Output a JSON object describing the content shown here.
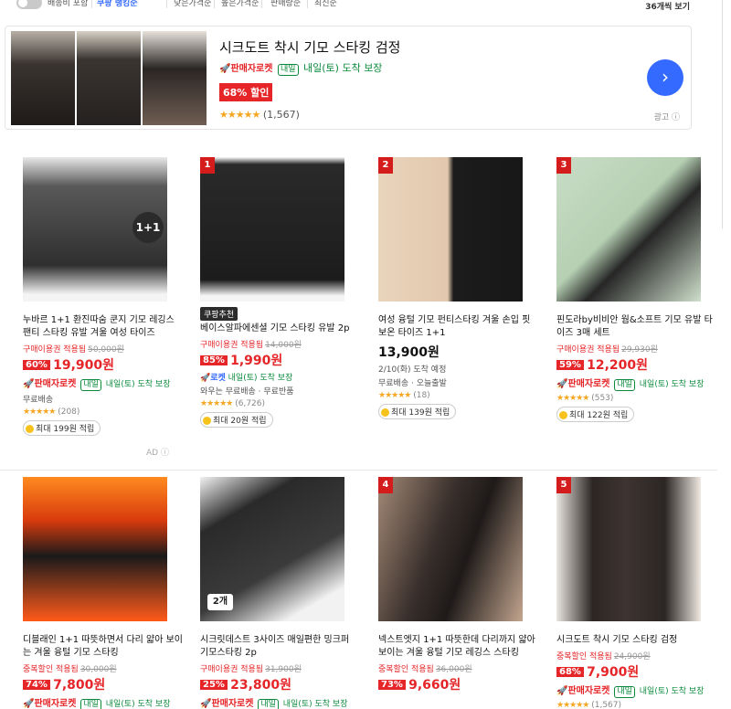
{
  "filters": {
    "delivery_toggle_label": "배송비 포함",
    "sort_options": [
      "쿠팡 랭킹순",
      "낮은가격순",
      "높은가격순",
      "판매량순",
      "최신순"
    ],
    "selected_sort": "쿠팡 랭킹순",
    "view_count": "36개씩 보기"
  },
  "ad": {
    "title": "시크도트 착시 기모 스타킹 검정",
    "rocket": "판매자로켓",
    "next_day": "내일",
    "arrival": "내일(토) 도착 보장",
    "discount": "68% 할인",
    "stars": "★★★★★",
    "reviews": "(1,567)",
    "ad_label": "광고"
  },
  "products": [
    {
      "rank": "",
      "badge": "1+1",
      "name": "누바르 1+1 환진따숨 쿤지 기모 레깅스 팬티 스타킹 유발 겨울 여성 타이즈",
      "coupon": "구매이용권 적용됨",
      "orig": "50,000원",
      "disc": "60%",
      "price": "19,900원",
      "rocket": "판매자로켓",
      "nd": "내일",
      "arrival": "내일(토) 도착 보장",
      "extra": "무료배송",
      "stars": "★★★★★",
      "reviews": "(208)",
      "point": "최대 199원 적립",
      "reco": ""
    },
    {
      "rank": "1",
      "badge": "",
      "name": "베이스알파에센셜 기모 스타킹 유발 2p",
      "coupon": "구매이용권 적용됨",
      "orig": "14,000원",
      "disc": "85%",
      "price": "1,990원",
      "rocket": "로켓",
      "nd": "",
      "arrival": "내일(토) 도착 보장",
      "extra": "와우는 무료배송 · 무료반품",
      "stars": "★★★★★",
      "reviews": "(6,726)",
      "point": "최대 20원 적립",
      "reco": "쿠팡추천"
    },
    {
      "rank": "2",
      "badge": "",
      "name": "여성 융털 기모 펀티스타킹 겨울 손입 핏 보온 타이즈 1+1",
      "coupon": "",
      "orig": "",
      "disc": "",
      "price": "13,900원",
      "rocket": "",
      "nd": "",
      "arrival": "2/10(화) 도착 예정",
      "extra": "무료배송 · 오늘출발",
      "stars": "★★★★★",
      "reviews": "(18)",
      "point": "최대 139원 적립",
      "reco": ""
    },
    {
      "rank": "3",
      "badge": "",
      "name": "핀도라by비비안 웜&소프트 기모 유발 타이즈 3매 세트",
      "coupon": "구매이용권 적용됨",
      "orig": "29,930원",
      "disc": "59%",
      "price": "12,200원",
      "rocket": "판매자로켓",
      "nd": "내일",
      "arrival": "내일(토) 도착 보장",
      "extra": "",
      "stars": "★★★★★",
      "reviews": "(553)",
      "point": "최대 122원 적립",
      "reco": ""
    },
    {
      "rank": "",
      "badge": "",
      "name": "디블래인 1+1 따뜻하면서 다리 얇아 보이는 겨울 융털 기모 스타킹",
      "coupon": "중복할인 적용됨",
      "orig": "30,000원",
      "disc": "74%",
      "price": "7,800원",
      "rocket": "판매자로켓",
      "nd": "내일",
      "arrival": "내일(토) 도착 보장",
      "extra": "",
      "stars": "",
      "reviews": "",
      "point": "",
      "reco": ""
    },
    {
      "rank": "",
      "badge": "2개",
      "name": "시크릿데스트 3사이즈 매일편한 밍크퍼 기모스타킹 2p",
      "coupon": "구매이용권 적용됨",
      "orig": "31,900원",
      "disc": "25%",
      "price": "23,800원",
      "rocket": "판매자로켓",
      "nd": "내일",
      "arrival": "내일(토) 도착 보장",
      "extra": "",
      "stars": "",
      "reviews": "",
      "point": "",
      "reco": ""
    },
    {
      "rank": "4",
      "badge": "",
      "name": "넥스트엣지 1+1 따뜻한데 다리까지 얇아보이는 겨울 융털 기모 레깅스 스타킹",
      "coupon": "중복할인 적용됨",
      "orig": "36,000원",
      "disc": "73%",
      "price": "9,660원",
      "rocket": "",
      "nd": "",
      "arrival": "",
      "extra": "",
      "stars": "",
      "reviews": "",
      "point": "",
      "reco": ""
    },
    {
      "rank": "5",
      "badge": "",
      "name": "시크도트 착시 기모 스타킹 검정",
      "coupon": "중복할인 적용됨",
      "orig": "24,900원",
      "disc": "68%",
      "price": "7,900원",
      "rocket": "판매자로켓",
      "nd": "내일",
      "arrival": "내일(토) 도착 보장",
      "extra": "",
      "stars": "★★★★★",
      "reviews": "(1,567)",
      "point": "",
      "reco": ""
    }
  ],
  "ad_badge": "AD",
  "colors": {
    "accent": "#346aff",
    "sale": "#e52528",
    "rank": "#d41c1c",
    "star": "#f5a623",
    "next_day": "#0b8a3c"
  }
}
